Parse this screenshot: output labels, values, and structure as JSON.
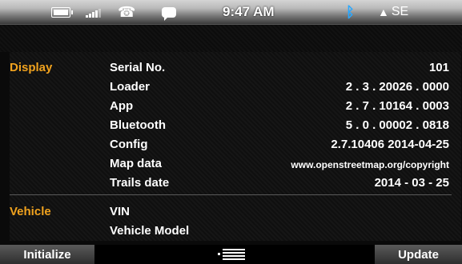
{
  "status_bar": {
    "time": "9:47 AM",
    "heading": "SE",
    "icons": [
      "battery-icon",
      "signal-icon",
      "phone-icon",
      "message-icon",
      "bluetooth-icon",
      "compass-arrow-icon"
    ]
  },
  "sections": [
    {
      "label": "Display",
      "rows": [
        {
          "label": "Serial No.",
          "value": "101"
        },
        {
          "label": "Loader",
          "value": "2 . 3 . 20026 . 0000"
        },
        {
          "label": "App",
          "value": "2 . 7 . 10164 . 0003"
        },
        {
          "label": "Bluetooth",
          "value": "5 . 0 . 00002 . 0818"
        },
        {
          "label": "Config",
          "value": "2.7.10406 2014-04-25"
        },
        {
          "label": "Map data",
          "value": "www.openstreetmap.org/copyright"
        },
        {
          "label": "Trails date",
          "value": "2014 - 03 - 25"
        }
      ]
    },
    {
      "label": "Vehicle",
      "rows": [
        {
          "label": "VIN",
          "value": ""
        },
        {
          "label": "Vehicle Model",
          "value": ""
        }
      ]
    }
  ],
  "softkeys": {
    "left": "Initialize",
    "right": "Update"
  },
  "colors": {
    "accent": "#f0a21e",
    "bluetooth": "#2aa8ff"
  }
}
